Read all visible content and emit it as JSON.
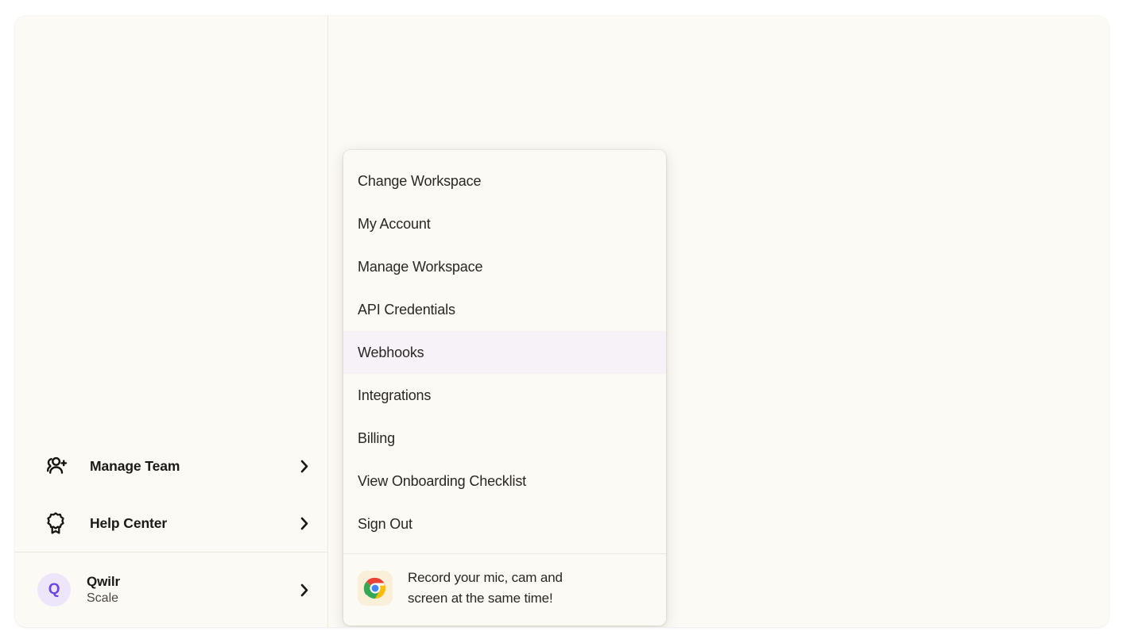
{
  "app": {
    "background_color": "#FCFAF5",
    "page_background": "#FFFFFF"
  },
  "sidebar": {
    "items": [
      {
        "label": "Manage Team",
        "icon": "users-add-icon",
        "chevron": "chevron-right-icon"
      },
      {
        "label": "Help Center",
        "icon": "award-badge-icon",
        "chevron": "chevron-right-icon"
      }
    ],
    "account": {
      "avatar_initial": "Q",
      "avatar_bg": "#EDE6FB",
      "avatar_color": "#6B46E5",
      "name": "Qwilr",
      "plan": "Scale",
      "chevron": "chevron-right-icon"
    }
  },
  "dropdown": {
    "highlight_color": "#F6F2F8",
    "items": [
      {
        "label": "Change Workspace",
        "active": false
      },
      {
        "label": "My Account",
        "active": false
      },
      {
        "label": "Manage Workspace",
        "active": false
      },
      {
        "label": "API Credentials",
        "active": false
      },
      {
        "label": "Webhooks",
        "active": true
      },
      {
        "label": "Integrations",
        "active": false
      },
      {
        "label": "Billing",
        "active": false
      },
      {
        "label": "View Onboarding Checklist",
        "active": false
      },
      {
        "label": "Sign Out",
        "active": false
      }
    ],
    "promo": {
      "icon": "chrome-logo-icon",
      "icon_bg": "#FAEFD8",
      "line1": "Record your mic, cam and",
      "line2": "screen at the same time!"
    }
  }
}
